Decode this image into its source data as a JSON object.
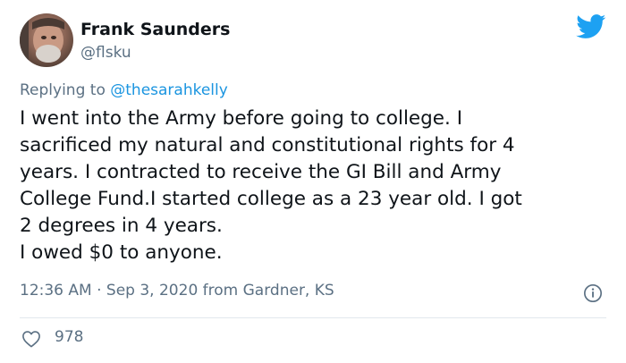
{
  "author": {
    "name": "Frank Saunders",
    "handle": "@flsku"
  },
  "reply": {
    "prefix": "Replying to",
    "mention": "@thesarahkelly"
  },
  "body_lines": [
    "I went into the Army before going to college.  I",
    "sacrificed my natural and constitutional rights for 4",
    "years.  I contracted to receive the GI Bill and Army",
    "College Fund.I started college as a 23 year old.  I got",
    "2 degrees in 4 years.",
    "I owed $0 to anyone."
  ],
  "meta": {
    "time": "12:36 AM",
    "separator": "·",
    "date": "Sep 3, 2020",
    "source": "from Gardner, KS"
  },
  "stats": {
    "likes": "978"
  },
  "icons": {
    "brand": "twitter-bird-icon",
    "info": "info-icon",
    "like": "heart-icon"
  },
  "colors": {
    "brand": "#1da1f2",
    "link": "#1b95e0",
    "secondary_text": "#5b7083",
    "primary_text": "#0f1419",
    "divider": "#e1e8ed"
  }
}
